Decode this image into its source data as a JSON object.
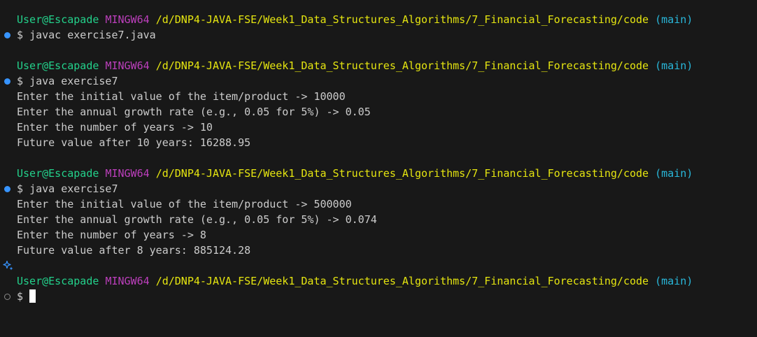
{
  "colors": {
    "background": "#181818",
    "text": "#cccccc",
    "user_host": "#23d18b",
    "mingw": "#bc3fbc",
    "path": "#e5e510",
    "branch": "#29b8db",
    "decoration_success": "#3794ff"
  },
  "prompt": {
    "user_host": "User@Escapade",
    "env": "MINGW64",
    "path": "/d/DNP4-JAVA-FSE/Week1_Data_Structures_Algorithms/7_Financial_Forecasting/code",
    "branch": "(main)",
    "symbol": "$"
  },
  "blocks": [
    {
      "command": "javac exercise7.java",
      "output": []
    },
    {
      "command": "java exercise7",
      "output": [
        "Enter the initial value of the item/product -> 10000",
        "Enter the annual growth rate (e.g., 0.05 for 5%) -> 0.05",
        "Enter the number of years -> 10",
        "Future value after 10 years: 16288.95"
      ]
    },
    {
      "command": "java exercise7",
      "output": [
        "Enter the initial value of the item/product -> 500000",
        "Enter the annual growth rate (e.g., 0.05 for 5%) -> 0.074",
        "Enter the number of years -> 8",
        "Future value after 8 years: 885124.28"
      ]
    }
  ],
  "icons": {
    "sparkle": "sparkle-icon",
    "success": "command-success-decoration-icon",
    "pending": "command-pending-decoration-icon"
  }
}
